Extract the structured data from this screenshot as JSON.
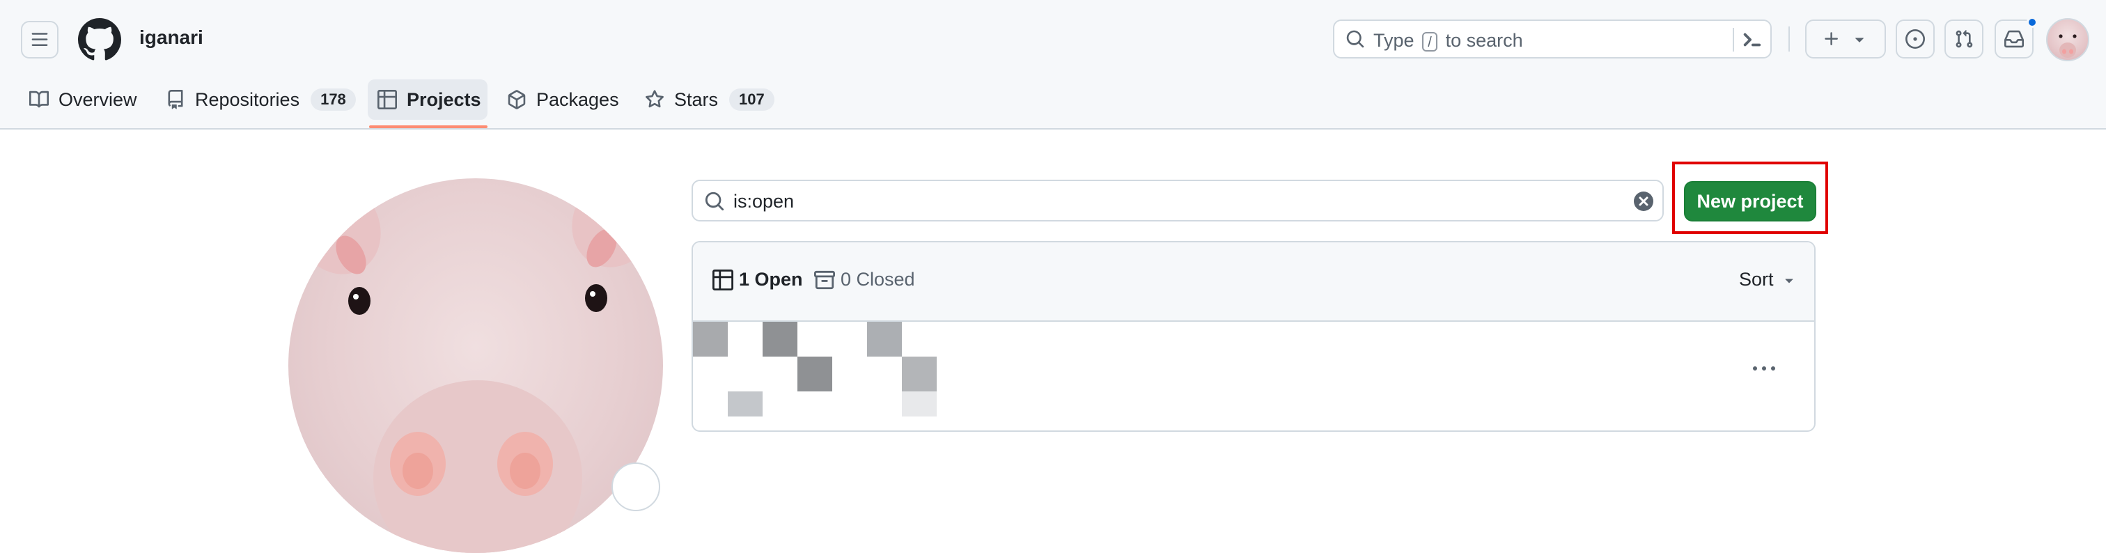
{
  "header": {
    "username": "iganari",
    "search": {
      "prefix": "Type",
      "key": "/",
      "suffix": "to search"
    }
  },
  "nav": {
    "tabs": [
      {
        "label": "Overview",
        "icon": "book-icon"
      },
      {
        "label": "Repositories",
        "icon": "repo-icon",
        "count": "178"
      },
      {
        "label": "Projects",
        "icon": "table-icon",
        "active": true
      },
      {
        "label": "Packages",
        "icon": "package-icon"
      },
      {
        "label": "Stars",
        "icon": "star-icon",
        "count": "107"
      }
    ]
  },
  "projects": {
    "filter_value": "is:open",
    "new_project_label": "New project",
    "open_label": "1 Open",
    "closed_label": "0 Closed",
    "sort_label": "Sort"
  },
  "colors": {
    "primary_button": "#1f883d",
    "active_tab_underline": "#fd8c73",
    "notification_dot": "#0969da",
    "highlight_box": "#e00000"
  }
}
